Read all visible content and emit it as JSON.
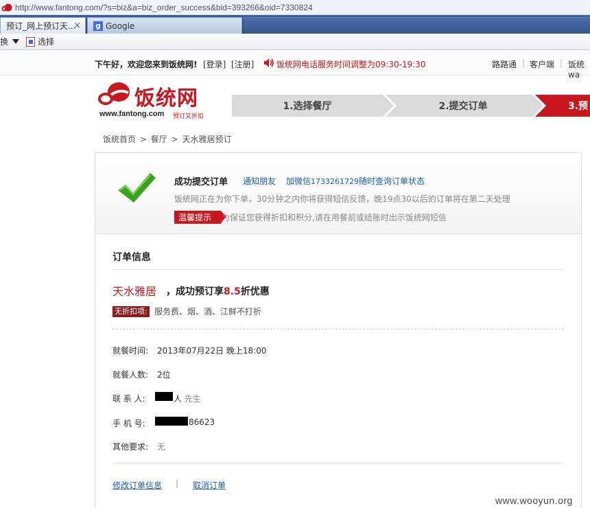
{
  "browser": {
    "url": "http://www.fantong.com/?s=biz&a=biz_order_success&bid=393266&oid=7330824",
    "tabs": [
      {
        "label": "预订_网上预订天...",
        "close": "×"
      },
      {
        "label": "Google"
      }
    ],
    "toolbar": {
      "switch_label": "换",
      "select_label": "选择"
    }
  },
  "topbar": {
    "welcome": "下午好，欢迎您来到饭统网!",
    "login": "[登录]",
    "register": "[注册]",
    "notice": "饭统网电话服务时间调整为09:30-19:30",
    "links": [
      "路路通",
      "客户端",
      "饭统wa"
    ]
  },
  "header": {
    "logo_text": "饭统网",
    "logo_url": "www.fantong.com",
    "logo_slogan": "预订又折扣",
    "steps": [
      "1.选择餐厅",
      "2.提交订单",
      "3.预"
    ]
  },
  "breadcrumb": [
    "饭统首页",
    ">",
    "餐厅",
    ">",
    "天水雅居预订"
  ],
  "success": {
    "title": "成功提交订单",
    "notify_friend": "通知朋友",
    "wechat_prefix": "加微信",
    "wechat_number": "1733261729",
    "wechat_suffix": "随时查询订单状态",
    "desc": "饭统网正在为你下单，30分钟之内你将获得短信反馈，晚19点30以后的订单将在第二天处理",
    "tip_label": "温馨提示",
    "tip_text": "为保证您获得折扣和积分,请在用餐前或结账时出示饭统网短信"
  },
  "order": {
    "heading": "订单信息",
    "restaurant": "天水雅居",
    "deal_prefix": "，成功预订享",
    "deal_discount": "8.5",
    "deal_suffix": "折优惠",
    "no_discount_label": "无折扣项:",
    "no_discount_items": "服务费、烟、酒、江鲜不打折",
    "rows": [
      {
        "label": "就餐时间:",
        "value": "2013年07月22日 晚上18:00"
      },
      {
        "label": "就餐人数:",
        "value": "2位"
      },
      {
        "label": "联 系 人:",
        "value": "人",
        "suffix": "先生"
      },
      {
        "label": "手 机 号:",
        "value": "86623"
      },
      {
        "label": "其他要求:",
        "value": "无"
      }
    ],
    "modify_link": "修改订单信息",
    "divider": "|",
    "cancel_link": "取消订单"
  },
  "watermark": "www.wooyun.org",
  "colors": {
    "brand_red": "#c8171f",
    "link_blue": "#1a5fa8",
    "check_green": "#3aa31c"
  }
}
